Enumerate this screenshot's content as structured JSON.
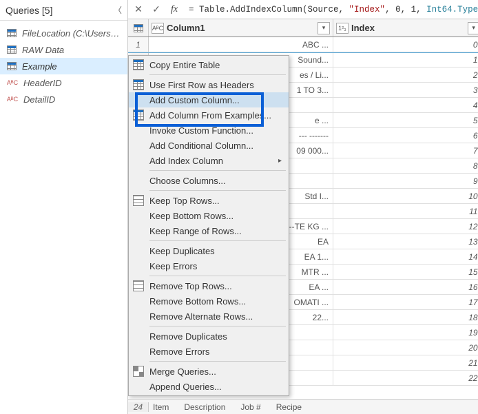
{
  "queries": {
    "header": "Queries [5]",
    "items": [
      {
        "label": "FileLocation (C:\\Users\\lisde...",
        "icon": "table",
        "selected": false
      },
      {
        "label": "RAW Data",
        "icon": "table",
        "selected": false
      },
      {
        "label": "Example",
        "icon": "table",
        "selected": true
      },
      {
        "label": "HeaderID",
        "icon": "abc",
        "selected": false
      },
      {
        "label": "DetailID",
        "icon": "abc",
        "selected": false
      }
    ]
  },
  "formula_bar": {
    "prefix": "= Table.AddIndexColumn(Source, ",
    "str1": "\"Index\"",
    "mid": ", 0, 1, ",
    "typ": "Int64.Type",
    "suffix": ")"
  },
  "columns": {
    "col1": {
      "type_label": "AᴮC",
      "name": "Column1"
    },
    "col2": {
      "type_label": "1²₃",
      "name": "Index"
    }
  },
  "rows": [
    {
      "c1": "ABC ...",
      "c2": "0"
    },
    {
      "c1": "Sound...",
      "c2": "1"
    },
    {
      "c1": "es / Li...",
      "c2": "2"
    },
    {
      "c1": "1 TO 3...",
      "c2": "3"
    },
    {
      "c1": "",
      "c2": "4"
    },
    {
      "c1": "e ...",
      "c2": "5"
    },
    {
      "c1": "--- -------",
      "c2": "6"
    },
    {
      "c1": "09 000...",
      "c2": "7"
    },
    {
      "c1": "",
      "c2": "8"
    },
    {
      "c1": "",
      "c2": "9"
    },
    {
      "c1": "Std I...",
      "c2": "10"
    },
    {
      "c1": "",
      "c2": "11"
    },
    {
      "c1": "--TE KG ...",
      "c2": "12"
    },
    {
      "c1": "EA",
      "c2": "13"
    },
    {
      "c1": "EA   1...",
      "c2": "14"
    },
    {
      "c1": "MTR ...",
      "c2": "15"
    },
    {
      "c1": "EA ...",
      "c2": "16"
    },
    {
      "c1": "OMATI ...",
      "c2": "17"
    },
    {
      "c1": "22...",
      "c2": "18"
    },
    {
      "c1": "",
      "c2": "19"
    },
    {
      "c1": "",
      "c2": "20"
    },
    {
      "c1": "",
      "c2": "21"
    },
    {
      "c1": "",
      "c2": "22"
    }
  ],
  "bottom_row": {
    "num": "24",
    "cells": [
      "Item",
      "Description",
      "Job #",
      "Recipe"
    ]
  },
  "context_menu": {
    "items": [
      {
        "label": "Copy Entire Table",
        "icon": "table-ic"
      },
      {
        "sep": true
      },
      {
        "label": "Use First Row as Headers",
        "icon": "table-ic"
      },
      {
        "label": "Add Custom Column...",
        "hovered": true
      },
      {
        "label": "Add Column From Examples...",
        "icon": "table-ic"
      },
      {
        "label": "Invoke Custom Function..."
      },
      {
        "label": "Add Conditional Column..."
      },
      {
        "label": "Add Index Column",
        "submenu": true
      },
      {
        "sep": true
      },
      {
        "label": "Choose Columns..."
      },
      {
        "sep": true
      },
      {
        "label": "Keep Top Rows...",
        "icon": "rows-ic"
      },
      {
        "label": "Keep Bottom Rows..."
      },
      {
        "label": "Keep Range of Rows..."
      },
      {
        "sep": true
      },
      {
        "label": "Keep Duplicates"
      },
      {
        "label": "Keep Errors"
      },
      {
        "sep": true
      },
      {
        "label": "Remove Top Rows...",
        "icon": "rows-ic"
      },
      {
        "label": "Remove Bottom Rows..."
      },
      {
        "label": "Remove Alternate Rows..."
      },
      {
        "sep": true
      },
      {
        "label": "Remove Duplicates"
      },
      {
        "label": "Remove Errors"
      },
      {
        "sep": true
      },
      {
        "label": "Merge Queries...",
        "icon": "merge-ic"
      },
      {
        "label": "Append Queries..."
      }
    ]
  }
}
